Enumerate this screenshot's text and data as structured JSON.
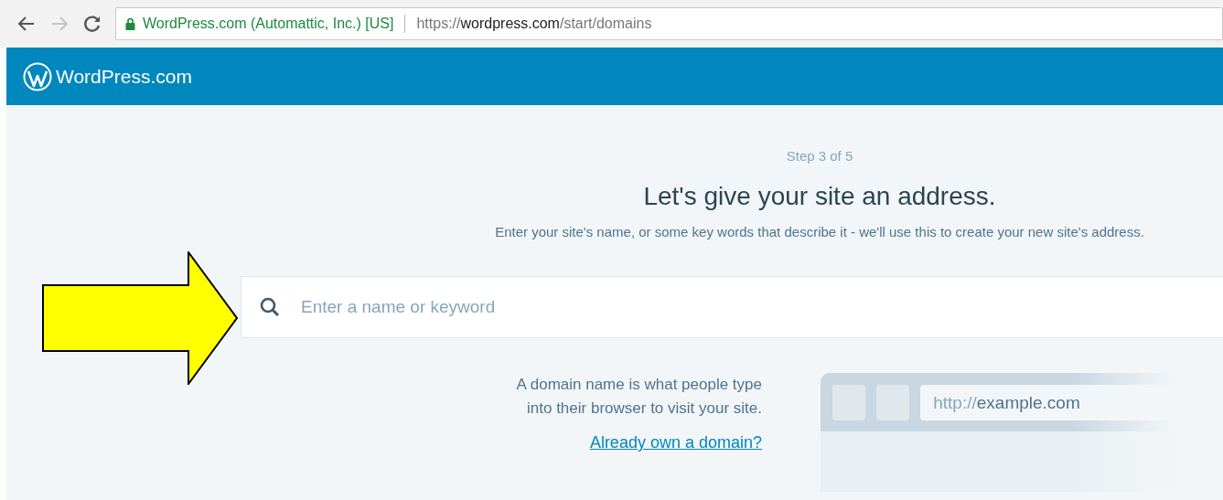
{
  "browser": {
    "security_label": "WordPress.com (Automattic, Inc.) [US]",
    "url": {
      "scheme": "https://",
      "host": "wordpress.com",
      "path": "/start/domains"
    },
    "forward_disabled": true
  },
  "header": {
    "brand": "WordPress.com"
  },
  "step": "Step 3 of 5",
  "title": "Let's give your site an address.",
  "subtitle": "Enter your site's name, or some key words that describe it - we'll use this to create your new site's address.",
  "search": {
    "placeholder": "Enter a name or keyword"
  },
  "info": {
    "text_lines": [
      "A domain name is what people type",
      "into their browser to visit your site."
    ],
    "link": "Already own a domain?"
  },
  "mockup": {
    "scheme": "http://",
    "host": "example.com"
  }
}
